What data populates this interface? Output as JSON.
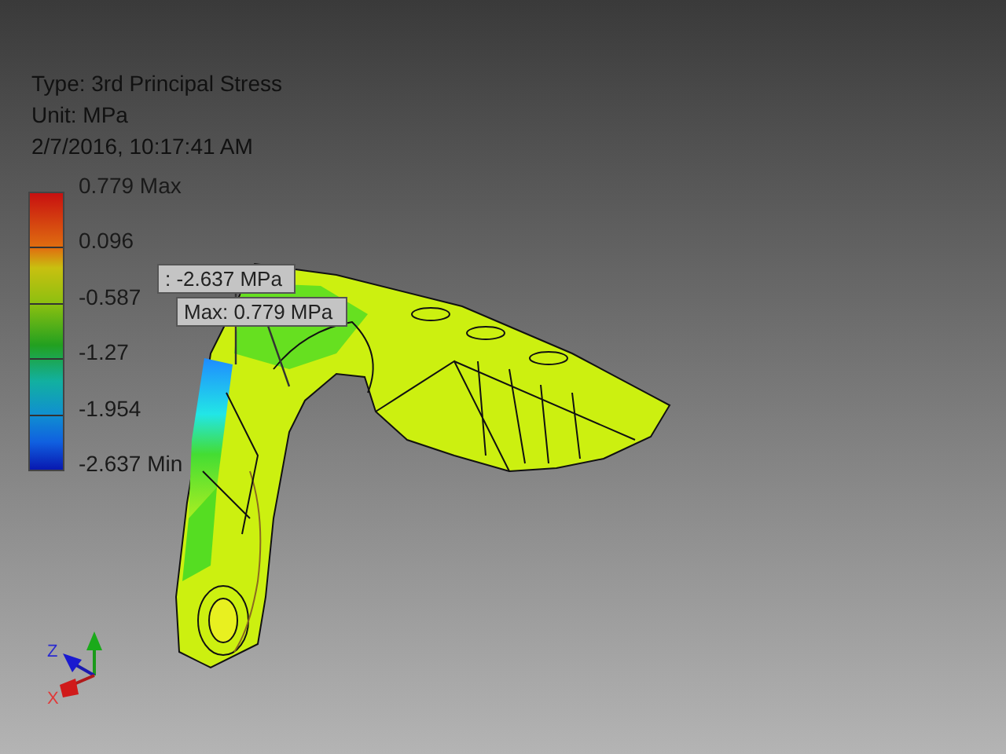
{
  "result_info": {
    "type": "Type: 3rd Principal Stress",
    "unit": "Unit: MPa",
    "timestamp": "2/7/2016, 10:17:41 AM"
  },
  "legend": {
    "ticks": [
      {
        "label": "0.779 Max"
      },
      {
        "label": "0.096"
      },
      {
        "label": "-0.587"
      },
      {
        "label": "-1.27"
      },
      {
        "label": "-1.954"
      },
      {
        "label": "-2.637 Min"
      }
    ]
  },
  "probes": [
    {
      "text": ": -2.637 MPa"
    },
    {
      "text": "Max: 0.779 MPa"
    }
  ],
  "triad": {
    "z_label": "Z",
    "x_label": "X"
  }
}
